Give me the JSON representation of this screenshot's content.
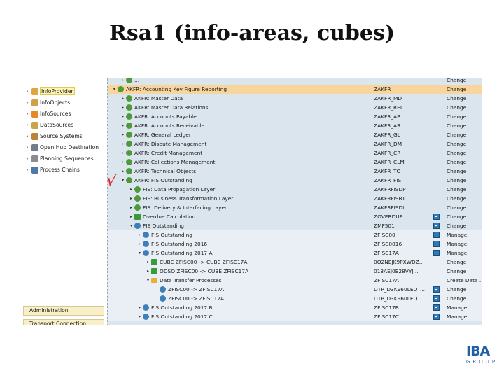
{
  "slide": {
    "title": "Rsa1 (info-areas, cubes)"
  },
  "left_nav": {
    "items": [
      {
        "label": "InfoProvider",
        "color": "#e1a63b",
        "active": true
      },
      {
        "label": "InfoObjects",
        "color": "#d2a04a"
      },
      {
        "label": "InfoSources",
        "color": "#e58a2a"
      },
      {
        "label": "DataSources",
        "color": "#c9a448"
      },
      {
        "label": "Source Systems",
        "color": "#b8863b"
      },
      {
        "label": "Open Hub Destination",
        "color": "#6f7d8c"
      },
      {
        "label": "Planning Sequences",
        "color": "#8c8c8c"
      },
      {
        "label": "Process Chains",
        "color": "#4d7aa8"
      }
    ],
    "admin": "Administration",
    "transport": "Transport Connection"
  },
  "tree": {
    "rows": [
      {
        "text": "...",
        "tech": "",
        "action": "Change",
        "level": 1,
        "type": "area",
        "arrow": "▸"
      },
      {
        "text": "AKFR: Accounting Key Figure Reporting",
        "tech": "ZAKFR",
        "action": "Change",
        "level": 0,
        "type": "area",
        "arrow": "▾",
        "selected": true
      },
      {
        "text": "AKFR: Master Data",
        "tech": "ZAKFR_MD",
        "action": "Change",
        "level": 1,
        "type": "area",
        "arrow": "▸"
      },
      {
        "text": "AKFR: Master Data Relations",
        "tech": "ZAKFR_REL",
        "action": "Change",
        "level": 1,
        "type": "area",
        "arrow": "▸"
      },
      {
        "text": "AKFR: Accounts Payable",
        "tech": "ZAKFR_AP",
        "action": "Change",
        "level": 1,
        "type": "area",
        "arrow": "▸"
      },
      {
        "text": "AKFR: Accounts Receivable",
        "tech": "ZAKFR_AR",
        "action": "Change",
        "level": 1,
        "type": "area",
        "arrow": "▸"
      },
      {
        "text": "AKFR: General Ledger",
        "tech": "ZAKFR_GL",
        "action": "Change",
        "level": 1,
        "type": "area",
        "arrow": "▸"
      },
      {
        "text": "AKFR: Dispute Management",
        "tech": "ZAKFR_DM",
        "action": "Change",
        "level": 1,
        "type": "area",
        "arrow": "▸"
      },
      {
        "text": "AKFR: Credit Management",
        "tech": "ZAKFR_CR",
        "action": "Change",
        "level": 1,
        "type": "area",
        "arrow": "▸"
      },
      {
        "text": "AKFR: Collections Management",
        "tech": "ZAKFR_CLM",
        "action": "Change",
        "level": 1,
        "type": "area",
        "arrow": "▸"
      },
      {
        "text": "AKFR: Technical Objects",
        "tech": "ZAKFR_TO",
        "action": "Change",
        "level": 1,
        "type": "area",
        "arrow": "▸"
      },
      {
        "text": "AKFR: FIS Outstanding",
        "tech": "ZAKFR_FIS",
        "action": "Change",
        "level": 1,
        "type": "area",
        "arrow": "▾"
      },
      {
        "text": "FIS: Data Propagation Layer",
        "tech": "ZAKFRFISDP",
        "action": "Change",
        "level": 2,
        "type": "area",
        "arrow": "▸"
      },
      {
        "text": "FIS: Business Transformation Layer",
        "tech": "ZAKFRFISBT",
        "action": "Change",
        "level": 2,
        "type": "area",
        "arrow": "▸"
      },
      {
        "text": "FIS: Delivery & Interfacing Layer",
        "tech": "ZAKFRFISDI",
        "action": "Change",
        "level": 2,
        "type": "area",
        "arrow": "▸"
      },
      {
        "text": "Overdue Calculation",
        "tech": "ZOVERDUE",
        "action": "Change",
        "level": 2,
        "type": "cube",
        "arrow": "▸",
        "icon": true
      },
      {
        "text": "FIS Outstanding",
        "tech": "ZMF501",
        "action": "Change",
        "level": 2,
        "type": "multi",
        "arrow": "▾",
        "icon": true
      },
      {
        "text": "FIS Outstanding",
        "tech": "ZFISC00",
        "action": "Manage",
        "level": 3,
        "type": "multi",
        "arrow": "▸",
        "icon": true,
        "lite": true
      },
      {
        "text": "FIS Outstanding 2016",
        "tech": "ZFISC0016",
        "action": "Manage",
        "level": 3,
        "type": "multi",
        "arrow": "▸",
        "icon": true,
        "lite": true
      },
      {
        "text": "FIS Outstanding 2017 A",
        "tech": "ZFISC17A",
        "action": "Manage",
        "level": 3,
        "type": "multi",
        "arrow": "▾",
        "icon": true,
        "lite": true
      },
      {
        "text": "CUBE ZFISC00 -> CUBE ZFISC17A",
        "tech": "0O2NEJK9PXWDZ...",
        "action": "Change",
        "level": 4,
        "type": "cube",
        "arrow": "▸",
        "lite": true
      },
      {
        "text": "ODSO ZFISC00 -> CUBE ZFISC17A",
        "tech": "013AEJ0E28VYJ...",
        "action": "Change",
        "level": 4,
        "type": "cube",
        "arrow": "▸",
        "lite": true
      },
      {
        "text": "Data Transfer Processes",
        "tech": "ZFISC17A",
        "action": "Create Data ...",
        "level": 4,
        "type": "folder",
        "arrow": "▾",
        "lite": true
      },
      {
        "text": "ZFISC00 -> ZFISC17A",
        "tech": "DTP_D3K960LEQT...",
        "action": "Change",
        "level": 5,
        "type": "dtp",
        "arrow": "",
        "icon": true,
        "lite": true
      },
      {
        "text": "ZFISC00 -> ZFISC17A",
        "tech": "DTP_D3K960LEQT...",
        "action": "Change",
        "level": 5,
        "type": "dtp",
        "arrow": "",
        "icon": true,
        "lite": true
      },
      {
        "text": "FIS Outstanding 2017 B",
        "tech": "ZFISC17B",
        "action": "Manage",
        "level": 3,
        "type": "multi",
        "arrow": "▸",
        "icon": true,
        "lite": true
      },
      {
        "text": "FIS Outstanding 2017 C",
        "tech": "ZFISC17C",
        "action": "Manage",
        "level": 3,
        "type": "multi",
        "arrow": "▸",
        "icon": true,
        "lite": true
      }
    ]
  },
  "annotation": {
    "mark": "√"
  },
  "logo": {
    "big": "IBA",
    "small": "GROUP"
  },
  "colors": {
    "area_icon": "#4e9a3a",
    "multi_icon": "#3d7fb9",
    "cube_icon": "#3a9a3a",
    "folder_icon": "#e3b23c",
    "selected_row": "#f7d59c"
  }
}
